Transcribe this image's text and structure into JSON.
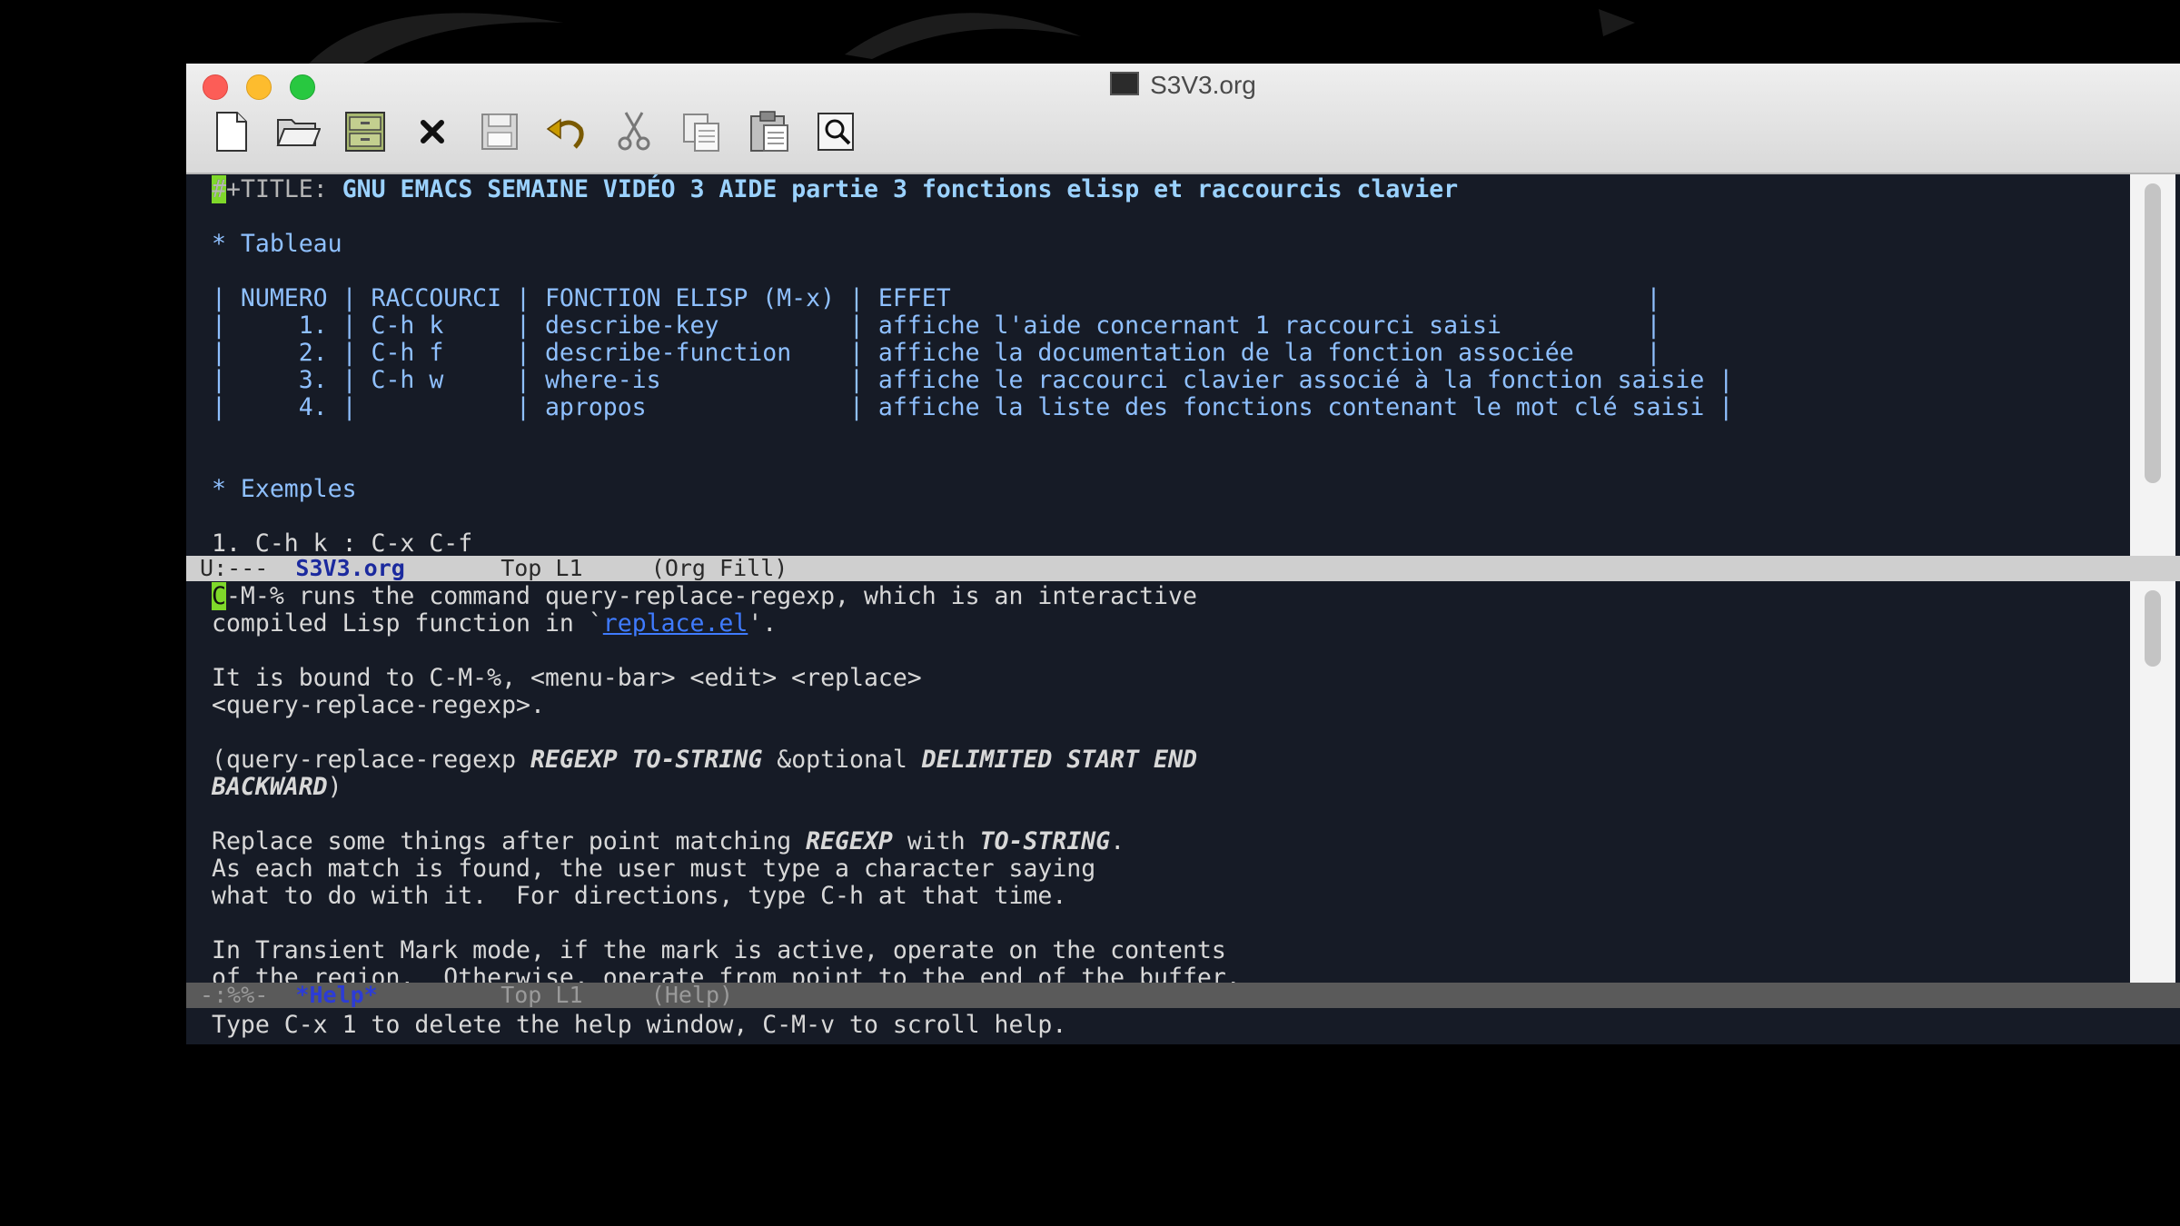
{
  "window": {
    "title": "S3V3.org"
  },
  "toolbar": {
    "buttons": [
      {
        "name": "new-file",
        "icon": "new-file-icon"
      },
      {
        "name": "open",
        "icon": "folder-open-icon"
      },
      {
        "name": "dired",
        "icon": "cabinet-icon"
      },
      {
        "name": "close",
        "icon": "close-icon"
      },
      {
        "name": "save",
        "icon": "floppy-icon"
      },
      {
        "name": "undo",
        "icon": "undo-icon"
      },
      {
        "name": "cut",
        "icon": "scissors-icon"
      },
      {
        "name": "copy",
        "icon": "copy-icon"
      },
      {
        "name": "paste",
        "icon": "clipboard-icon"
      },
      {
        "name": "search",
        "icon": "search-icon"
      }
    ]
  },
  "org_buffer": {
    "title_keyword": "#+TITLE:",
    "title_text": "GNU EMACS SEMAINE VIDÉO 3 AIDE partie 3 fonctions elisp et raccourcis clavier",
    "heading_table": "* Tableau",
    "table": {
      "header": "| NUMERO | RACCOURCI | FONCTION ELISP (M-x) | EFFET                                                |",
      "rows": [
        "|     1. | C-h k     | describe-key         | affiche l'aide concernant 1 raccourci saisi          |",
        "|     2. | C-h f     | describe-function    | affiche la documentation de la fonction associée     |",
        "|     3. | C-h w     | where-is             | affiche le raccourci clavier associé à la fonction saisie |",
        "|     4. |           | apropos              | affiche la liste des fonctions contenant le mot clé saisi |"
      ]
    },
    "heading_examples": "* Exemples",
    "example_line": "1. C-h k : C-x C-f"
  },
  "modeline_top": {
    "status": " U:---  ",
    "buffer": "S3V3.org",
    "position": "       Top L1     ",
    "mode": "(Org Fill)"
  },
  "help_buffer": {
    "cursor_char": "C",
    "line1_rest": "-M-% runs the command query-replace-regexp, which is an interactive",
    "line2_pre": "compiled Lisp function in `",
    "line2_link": "replace.el",
    "line2_post": "'.",
    "line4": "It is bound to C-M-%, <menu-bar> <edit> <replace>",
    "line5": "<query-replace-regexp>.",
    "line7_pre": "(query-replace-regexp ",
    "line7_args1": "REGEXP TO-STRING",
    "line7_mid": " &optional ",
    "line7_args2": "DELIMITED START END",
    "line8_args": "BACKWARD",
    "line8_post": ")",
    "line10_pre": "Replace some things after point matching ",
    "line10_arg1": "REGEXP",
    "line10_mid": " with ",
    "line10_arg2": "TO-STRING",
    "line10_post": ".",
    "line11": "As each match is found, the user must type a character saying",
    "line12": "what to do with it.  For directions, type C-h at that time.",
    "line14": "In Transient Mark mode, if the mark is active, operate on the contents",
    "line15": "of the region.  Otherwise, operate from point to the end of the buffer."
  },
  "modeline_help": {
    "status": " -:%%-  ",
    "buffer": "*Help*",
    "position": "         Top L1     ",
    "mode": "(Help)"
  },
  "minibuffer": {
    "text": "Type C-x 1 to delete the help window, C-M-v to scroll help."
  },
  "colors": {
    "editor_bg": "#161b26",
    "cursor": "#7fd82a",
    "heading": "#8fc0ff",
    "link": "#3f7bff"
  }
}
